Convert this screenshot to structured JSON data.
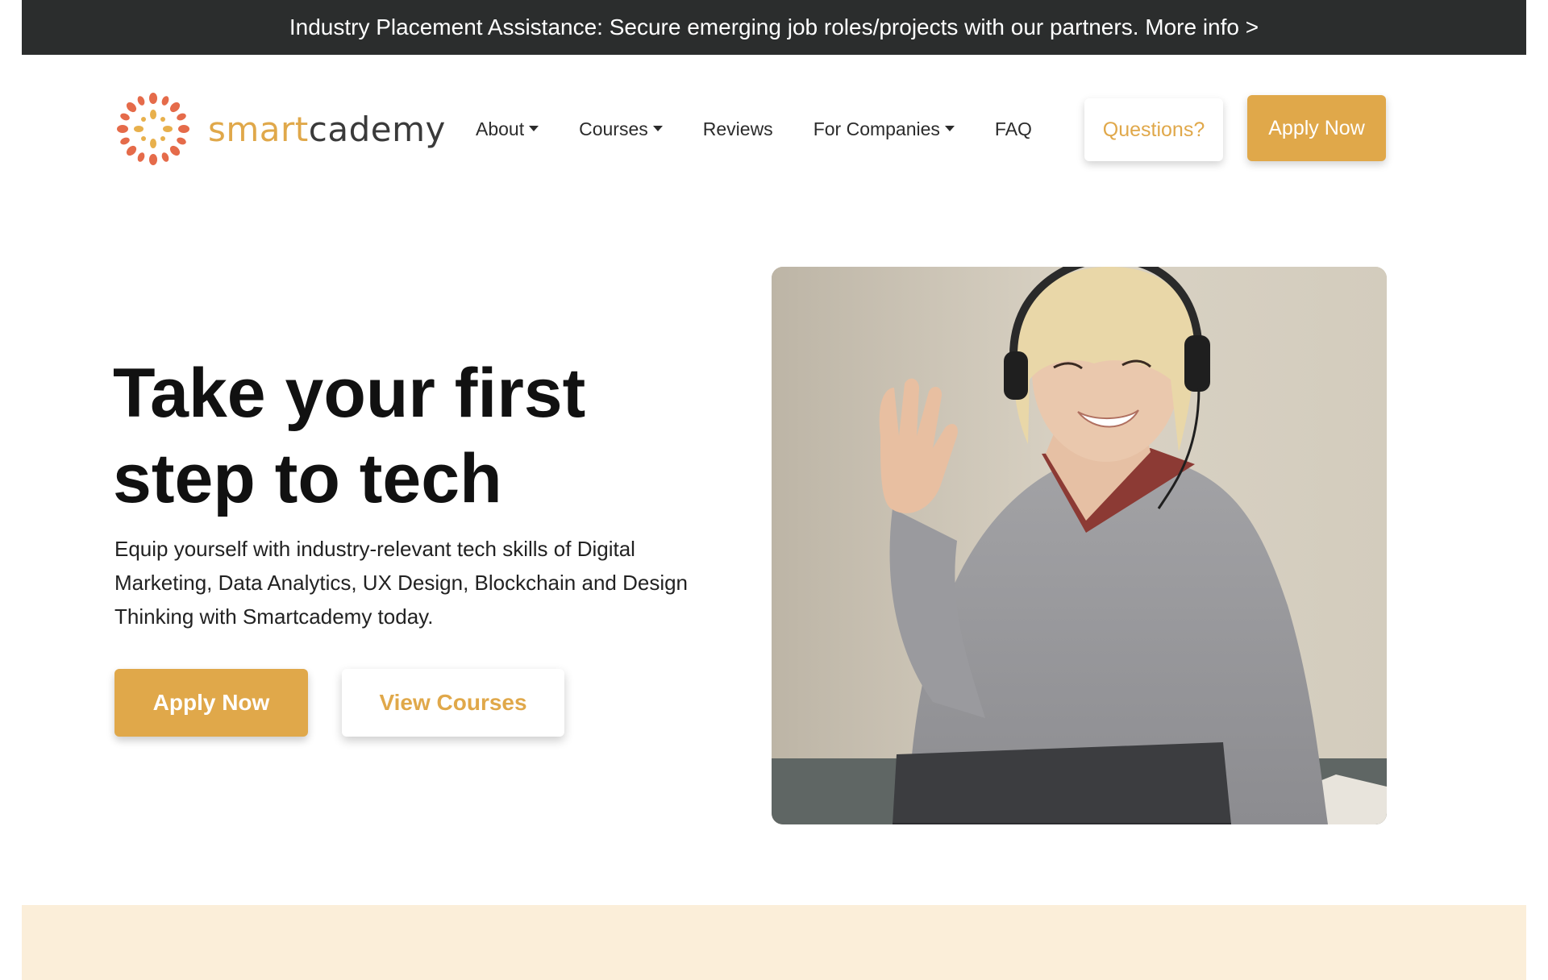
{
  "announcement": {
    "text": "Industry Placement Assistance: Secure emerging job roles/projects with our partners. More info >"
  },
  "brand": {
    "name_part1": "smart",
    "name_part2": "cademy",
    "primary_color": "#e0a84a",
    "logo_icon": "sunburst-dots-icon"
  },
  "nav": {
    "items": [
      {
        "label": "About",
        "has_dropdown": true
      },
      {
        "label": "Courses",
        "has_dropdown": true
      },
      {
        "label": "Reviews",
        "has_dropdown": false
      },
      {
        "label": "For Companies",
        "has_dropdown": true
      },
      {
        "label": "FAQ",
        "has_dropdown": false
      }
    ],
    "questions_label": "Questions?",
    "apply_label": "Apply Now"
  },
  "hero": {
    "title_line1": "Take your first",
    "title_line2": "step to tech",
    "description_line1": "Equip yourself with industry-relevant tech skills of Digital",
    "description_line2": "Marketing, Data Analytics, UX Design, Blockchain and Design",
    "description_line3": "Thinking with Smartcademy today.",
    "apply_label": "Apply Now",
    "courses_label": "View Courses"
  },
  "colors": {
    "announcement_bg": "#2b2d2d",
    "band_bg": "#fbeed9"
  }
}
